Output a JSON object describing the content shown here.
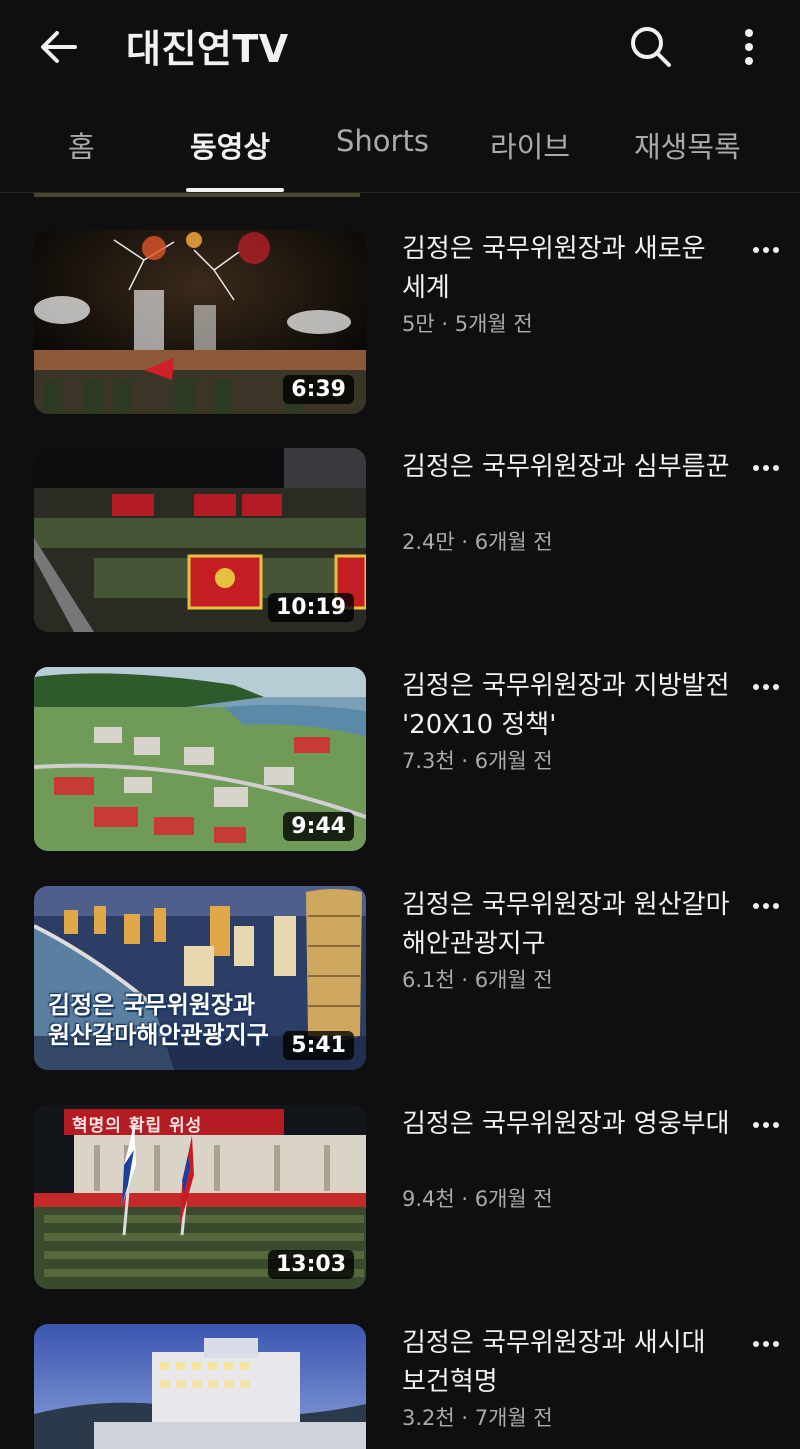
{
  "header": {
    "channel_title": "대진연TV",
    "back_icon": "arrow-left-icon",
    "search_icon": "search-icon",
    "more_icon": "more-vertical-icon"
  },
  "tabs": [
    {
      "label": "홈",
      "active": false
    },
    {
      "label": "동영상",
      "active": true
    },
    {
      "label": "Shorts",
      "active": false
    },
    {
      "label": "라이브",
      "active": false
    },
    {
      "label": "재생목록",
      "active": false
    }
  ],
  "videos": [
    {
      "title": "김정은 국무위원장과 새로운 세계",
      "meta": "5만 · 5개월 전",
      "duration": "6:39"
    },
    {
      "title": "김정은 국무위원장과 심부름꾼",
      "meta": "2.4만 · 6개월 전",
      "duration": "10:19"
    },
    {
      "title": "김정은 국무위원장과 지방발전 '20X10 정책'",
      "meta": "7.3천 · 6개월 전",
      "duration": "9:44"
    },
    {
      "title": "김정은 국무위원장과 원산갈마해안관광지구",
      "meta": "6.1천 · 6개월 전",
      "duration": "5:41",
      "thumb_caption_1": "김정은 국무위원장과",
      "thumb_caption_2": "원산갈마해안관광지구"
    },
    {
      "title": "김정은 국무위원장과 영웅부대",
      "meta": "9.4천 · 6개월 전",
      "duration": "13:03",
      "thumb_banner": "혁명의 확립 위성"
    },
    {
      "title": "김정은 국무위원장과 새시대 보건혁명",
      "meta": "3.2천 · 7개월 전",
      "duration": ""
    }
  ],
  "colors": {
    "background": "#0f0f0f",
    "text": "#f1f1f1",
    "secondary": "#aaaaaa"
  }
}
